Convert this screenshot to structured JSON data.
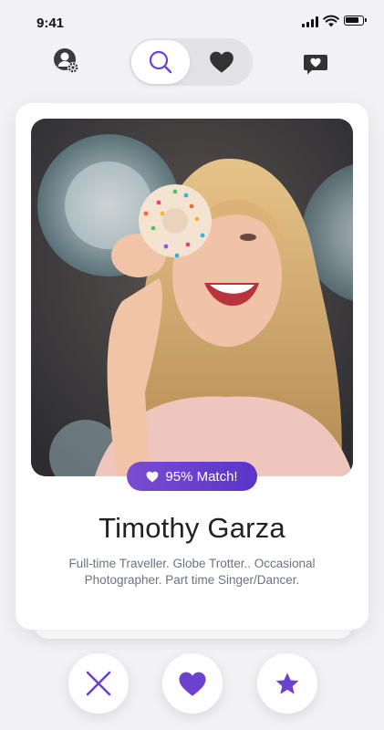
{
  "status_bar": {
    "time": "9:41"
  },
  "nav": {
    "profile_icon": "user-settings-icon",
    "tabs": [
      {
        "icon": "search-icon",
        "active": true
      },
      {
        "icon": "heart-icon",
        "active": false
      }
    ],
    "chat_icon": "chat-heart-icon"
  },
  "card": {
    "match_label": "95% Match!",
    "match_percent": 95,
    "name": "Timothy Garza",
    "bio": "Full-time Traveller. Globe Trotter.. Occasional Photographer. Part time Singer/Dancer."
  },
  "actions": [
    {
      "icon": "close-icon"
    },
    {
      "icon": "heart-icon"
    },
    {
      "icon": "star-icon"
    }
  ],
  "colors": {
    "accent": "#6b42cf",
    "background": "#f2f2f4",
    "text_primary": "#222222",
    "text_secondary": "#6e7185"
  }
}
